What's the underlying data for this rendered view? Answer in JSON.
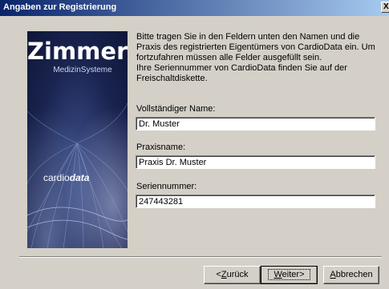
{
  "window": {
    "title": "Angaben zur Registrierung",
    "close_label": "X"
  },
  "branding": {
    "company": "Zimmer",
    "company_sub": "MedizinSysteme",
    "product_prefix": "cardio",
    "product_suffix": "data"
  },
  "intro": {
    "paragraph1": "Bitte tragen Sie in den Feldern unten den Namen und die Praxis des registrierten Eigentümers von CardioData ein. Um fortzufahren müssen alle Felder ausgefüllt sein.",
    "paragraph2": "Ihre Seriennummer von CardioData finden Sie auf der Freischaltdiskette."
  },
  "fields": {
    "name": {
      "label": "Vollständiger Name:",
      "value": "Dr. Muster"
    },
    "practice": {
      "label": "Praxisname:",
      "value": "Praxis Dr. Muster"
    },
    "serial": {
      "label": "Seriennummer:",
      "value": "247443281"
    }
  },
  "buttons": {
    "back": {
      "mnemonic": "Z",
      "rest": "urück",
      "prefix": "<"
    },
    "next": {
      "mnemonic": "W",
      "rest": "eiter>"
    },
    "cancel": {
      "mnemonic": "A",
      "rest": "bbrechen"
    }
  }
}
